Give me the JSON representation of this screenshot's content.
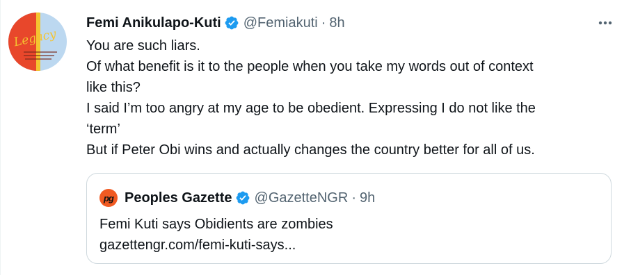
{
  "tweet": {
    "avatar": {
      "text": "Legacy",
      "alt_text_colors": [
        "#e8472b",
        "#bcd8f0"
      ]
    },
    "display_name": "Femi Anikulapo-Kuti",
    "handle": "@Femiakuti",
    "separator": "·",
    "time": "8h",
    "more_icon": "more-horizontal-icon",
    "verified_icon": "verified-badge-icon",
    "text_lines": [
      "You are such liars.",
      "Of what benefit is it to the people when you take my words out of context",
      "like this?",
      "I said I’m too angry at my age to be obedient. Expressing I do not like the",
      "‘term’",
      "But if Peter Obi wins and actually changes the country better for all of us."
    ]
  },
  "quote": {
    "logo_text": "pg",
    "display_name": "Peoples Gazette",
    "handle": "@GazetteNGR",
    "separator": "·",
    "time": "9h",
    "text_lines": [
      "Femi Kuti says Obidients are zombies",
      "gazettengr.com/femi-kuti-says..."
    ]
  },
  "colors": {
    "verified": "#1d9bf0",
    "secondary_text": "#536471",
    "border": "#cfd9de",
    "gazette_orange": "#f15a22"
  }
}
